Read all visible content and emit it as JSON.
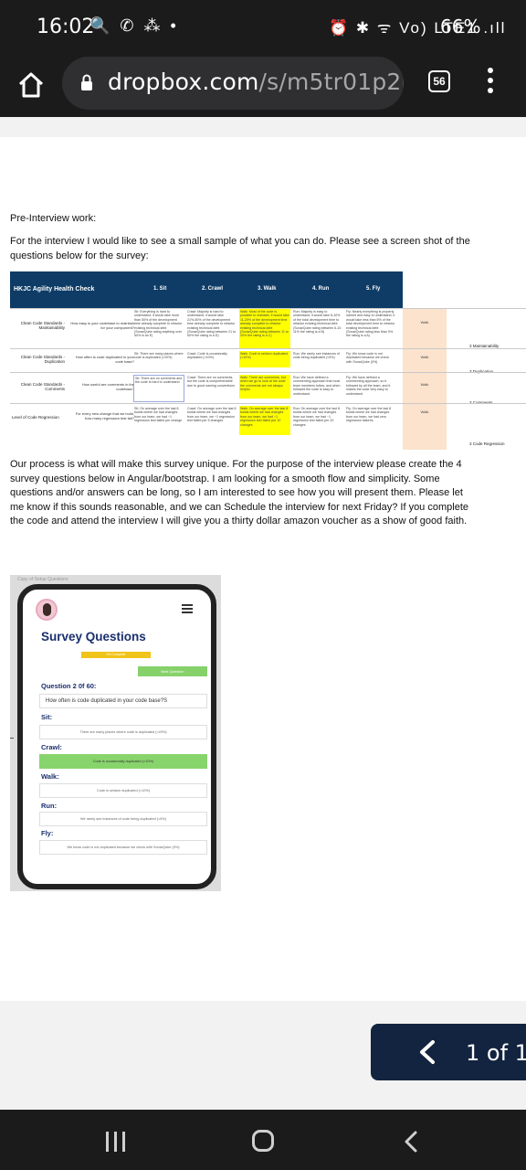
{
  "status_bar": {
    "time": "16:02",
    "left_icons": "🔍 ✆ ⁂ •",
    "right_icons": "⏰ ✱ ᯤ Vo) LTE1 .ıll",
    "battery": "66%"
  },
  "browser": {
    "url_domain": "dropbox.com",
    "url_path": "/s/m5tr01p2bio",
    "tab_count": "56"
  },
  "document": {
    "heading": "Pre-Interview work:",
    "intro": "For the interview I would like to see a small sample of what you can do. Please see a screen shot of the questions below for the survey:",
    "process": "Our process is what will make this survey unique. For the purpose of the interview please create the 4 survey questions below in Angular/bootstrap. I am looking for a smooth flow and simplicity. Some questions and/or answers can be long, so I am interested to see how you will present them. Please let me know if this sounds reasonable, and we can Schedule the interview for next Friday? If you complete the code and attend the interview I will give you a thirty dollar amazon voucher as a show of good faith."
  },
  "spreadsheet": {
    "title": "HKJC Agility Health Check",
    "columns": [
      "1. Sit",
      "2. Crawl",
      "3. Walk",
      "4. Run",
      "5. Fly"
    ],
    "rows": [
      {
        "label": "Clean Code Standards - Maintainability",
        "question": "How easy is your codebase to maintain for your component?",
        "cells": [
          "Sit: Everything is hard to understand, it would take more than 50% of the development time already complete to refactor existing technical debt (SonarQube rating anything over 50% is an E)",
          "Crawl: Majority is hard to understand, it would take 21%-50% of the development time already complete to refactor existing technical debt (SonarQube rating between 21 to 50% the rating is a D)",
          "Walk: Most of the code is possible to maintain, it would take 11-20% of the development time already complete to refactor existing technical debt (SonarQube rating between 11 to 20% the rating is a C)",
          "Run: Majority is easy to understand, it would take 6-10% of the total development time to refactor existing technical debt (SonarQube rating between 6-10 11% the rating is a B)",
          "Fly: Nearly everything is properly named and easy to understand, it would take less than 5% of the total development time to refactor existing technical debt (SonarQube rating less than 5% the rating is a A)"
        ],
        "status": "Walk",
        "tag": "3 Maintainability"
      },
      {
        "label": "Clean Code Standards - Duplication",
        "question": "How often is code duplicated in your code base?",
        "cells": [
          "Sit: There are many places where code is duplicated (>20%)",
          "Crawl: Code is occasionally duplicated (>10%)",
          "Walk: Code is seldom duplicated (<10%)",
          "Run: We rarely see instances of code being duplicated (<5%)",
          "Fly: We know code is not duplicated because we check with SonarQube (0%)"
        ],
        "status": "Walk",
        "tag": "3 Duplication"
      },
      {
        "label": "Clean Code Standards - Comments",
        "question": "How useful are comments in the codebase?",
        "cells": [
          "Sit: There are no comments and the code is hard to understand",
          "Crawl: There are no comments, but the code is comprehensible due to good naming conventions",
          "Walk: There are comments, but when we go to look at the code the comments are not always helpful",
          "Run: We have defined a commenting approach that most team members follow, and when followed the code is easy to understand",
          "Fly: We have defined a commenting approach, so it followed by all the team, and it makes the code very easy to understand"
        ],
        "status": "Walk",
        "tag": "3 Comments"
      },
      {
        "label": "Level of Code Regression",
        "question": "For every new change that we build, how many regression test fail?",
        "cells": [
          "Sit: On average over the last 8 builds where we had changes from our team, we had ~1 regression test failed per change",
          "Crawl: On average over the last 8 builds where we had changes from our team, we ~1 regression test failed per 5 changes",
          "Walk: On average over the last 8 builds where we had changes from our team, we had ~1 regression test failed per 10 changes",
          "Run: On average over the last 8 builds where we had changes from our team, we had ~1 regression test failed per 20 changes",
          "Fly: On average over the last 8 builds where we had changes from our team, we had zero regression failures."
        ],
        "status": "Walk",
        "tag": "3 Code Regression"
      }
    ]
  },
  "phone_mockup": {
    "caption": "Copy of Setup Questions",
    "title": "Survey Questions",
    "progress_label": "5% Complete",
    "next_button": "Next Question",
    "question_number": "Question 2 0f 60:",
    "question_text": "How often is code duplicated in your code base?S",
    "options": [
      {
        "level": "Sit:",
        "text": "There are many places where code is duplicated (>20%)",
        "selected": false
      },
      {
        "level": "Crawl:",
        "text": "Code is occasionally duplicated (>10%)",
        "selected": true
      },
      {
        "level": "Walk:",
        "text": "Code is seldom duplicated (<10%)",
        "selected": false
      },
      {
        "level": "Run:",
        "text": "We rarely see instances of code being duplicated (<5%)",
        "selected": false
      },
      {
        "level": "Fly:",
        "text": "We know code is not duplicated because we check with SonarQube (0%)",
        "selected": false
      }
    ]
  },
  "pager": {
    "page_text": "1 of 1"
  },
  "colors": {
    "header_navy": "#0e3c66",
    "highlight_yellow": "#ffff00",
    "selected_green": "#88d46c",
    "pager_bg": "#12243f"
  }
}
